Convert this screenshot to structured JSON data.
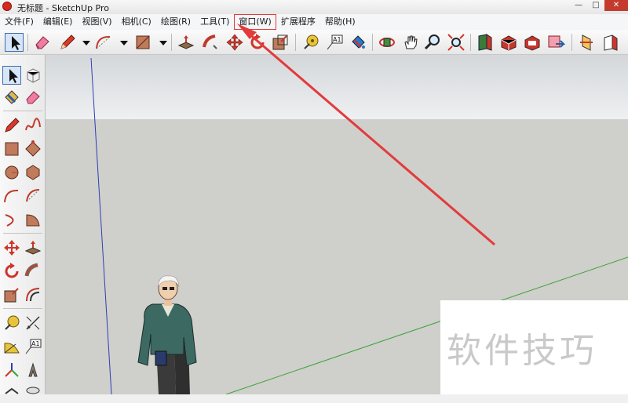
{
  "window": {
    "title": "无标题 - SketchUp Pro",
    "buttons": {
      "minimize": "—",
      "maximize": "□",
      "close": "✕"
    }
  },
  "menu": [
    {
      "label": "文件(F)"
    },
    {
      "label": "编辑(E)"
    },
    {
      "label": "视图(V)"
    },
    {
      "label": "相机(C)"
    },
    {
      "label": "绘图(R)"
    },
    {
      "label": "工具(T)"
    },
    {
      "label": "窗口(W)",
      "highlighted": true
    },
    {
      "label": "扩展程序"
    },
    {
      "label": "帮助(H)"
    }
  ],
  "toolbar_icons": [
    "select-icon",
    "eraser-icon",
    "pencil-icon",
    "dropdown-arrow-icon",
    "arc-icon",
    "dropdown-arrow-icon",
    "rectangle-icon",
    "dropdown-arrow-icon",
    "push-pull-icon",
    "follow-me-icon",
    "move-icon",
    "rotate-icon",
    "scale-icon",
    "tape-measure-icon",
    "text-label-icon",
    "paint-bucket-icon",
    "orbit-icon",
    "pan-icon",
    "zoom-icon",
    "zoom-extents-icon",
    "3d-warehouse-icon",
    "extension-warehouse-icon",
    "layout-icon",
    "send-to-layout-icon",
    "section-plane-icon",
    "section-cut-icon"
  ],
  "toolbar": {
    "text_tool_glyph": "A1"
  },
  "left_toolbar": {
    "text_tool_glyph": "A1"
  },
  "watermark": {
    "text": "软件技巧"
  },
  "colors": {
    "annotation": "#e23b3b",
    "axis_blue": "#2e3fb8",
    "axis_green": "#3aa33a",
    "sky": "#e4e6e8",
    "ground": "#cfcfcb",
    "selection": "#d6e6f8"
  }
}
